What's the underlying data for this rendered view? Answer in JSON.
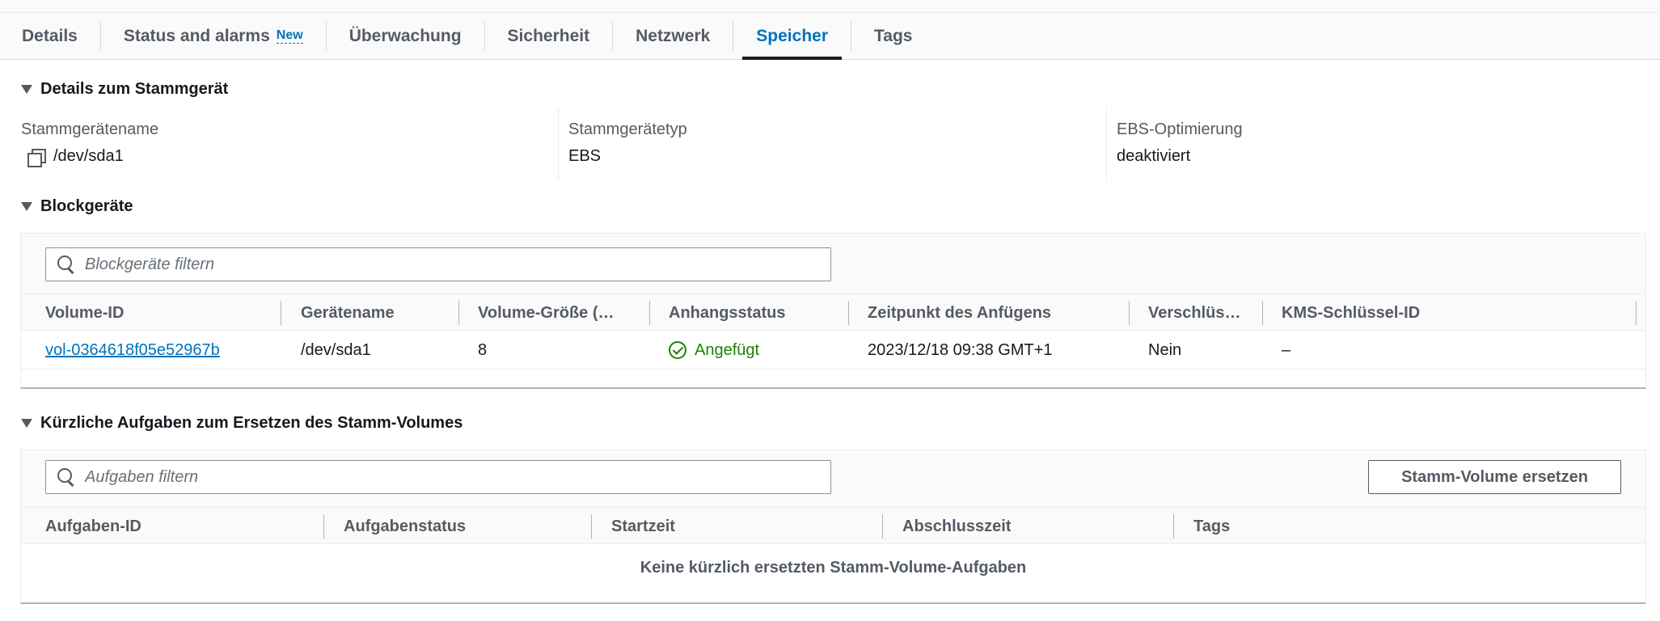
{
  "tabs": [
    {
      "label": "Details"
    },
    {
      "label": "Status and alarms",
      "badge": "New"
    },
    {
      "label": "Überwachung"
    },
    {
      "label": "Sicherheit"
    },
    {
      "label": "Netzwerk"
    },
    {
      "label": "Speicher",
      "active": true
    },
    {
      "label": "Tags"
    }
  ],
  "root_device": {
    "title": "Details zum Stammgerät",
    "name_label": "Stammgerätename",
    "name_value": "/dev/sda1",
    "type_label": "Stammgerätetyp",
    "type_value": "EBS",
    "ebs_label": "EBS-Optimierung",
    "ebs_value": "deaktiviert"
  },
  "block_devices": {
    "title": "Blockgeräte",
    "filter_placeholder": "Blockgeräte filtern",
    "columns": [
      "Volume-ID",
      "Gerätename",
      "Volume-Größe (…",
      "Anhangsstatus",
      "Zeitpunkt des Anfügens",
      "Verschlüs…",
      "KMS-Schlüssel-ID"
    ],
    "rows": [
      {
        "volume_id": "vol-0364618f05e52967b",
        "device_name": "/dev/sda1",
        "size": "8",
        "status": "Angefügt",
        "attach_time": "2023/12/18 09:38 GMT+1",
        "encrypted": "Nein",
        "kms_key": "–"
      }
    ]
  },
  "root_volume_tasks": {
    "title": "Kürzliche Aufgaben zum Ersetzen des Stamm-Volumes",
    "filter_placeholder": "Aufgaben filtern",
    "replace_button": "Stamm-Volume ersetzen",
    "columns": [
      "Aufgaben-ID",
      "Aufgabenstatus",
      "Startzeit",
      "Abschlusszeit",
      "Tags"
    ],
    "empty_text": "Keine kürzlich ersetzten Stamm-Volume-Aufgaben"
  },
  "colors": {
    "accent": "#0073bb",
    "success": "#1d8102",
    "text": "#16191f",
    "muted": "#545b64"
  }
}
